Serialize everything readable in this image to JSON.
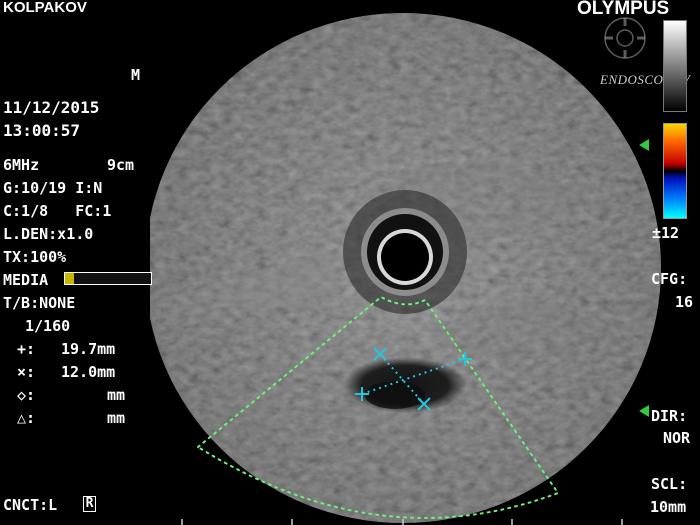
{
  "patient": {
    "name": "KOLPAKOV",
    "sex": "M"
  },
  "brand": {
    "logo": "OLYMPUS",
    "watermark": "ENDOSCOP.TV"
  },
  "datetime": {
    "date": "11/12/2015",
    "time": "13:00:57"
  },
  "params": {
    "frequency": "6MHz",
    "depth": "9cm",
    "gain_row": "G:10/19 I:N",
    "contrast_row": "C:1/8   FC:1",
    "line_density": "L.DEN:x1.0",
    "transmit": "TX:100%",
    "media_label": "MEDIA",
    "media_level": 0.1,
    "tb": "T/B:NONE",
    "frame": "1/160"
  },
  "measurements": [
    {
      "symbol": "+:",
      "value": "19.7mm"
    },
    {
      "symbol": "×:",
      "value": "12.0mm"
    },
    {
      "symbol": "◇:",
      "value": "mm"
    },
    {
      "symbol": "△:",
      "value": "mm"
    }
  ],
  "right_panel": {
    "scale_value": "±12",
    "cfg_label": "CFG:",
    "cfg_value": "16",
    "dir_label": "DIR:",
    "dir_value": "NOR",
    "scl_label": "SCL:",
    "scl_value": "10mm"
  },
  "connection": {
    "label": "CNCT:L",
    "mode": "R"
  },
  "colors": {
    "measure_cross": "#27c4dc",
    "roi_outline": "#6cf07a",
    "marker": "#2ecc40",
    "media_fill": "#c9b700"
  },
  "icons": [
    "olympus-logo",
    "gear-watermark-icon",
    "grayscale-bar",
    "color-scale-bar",
    "green-marker-icon"
  ]
}
